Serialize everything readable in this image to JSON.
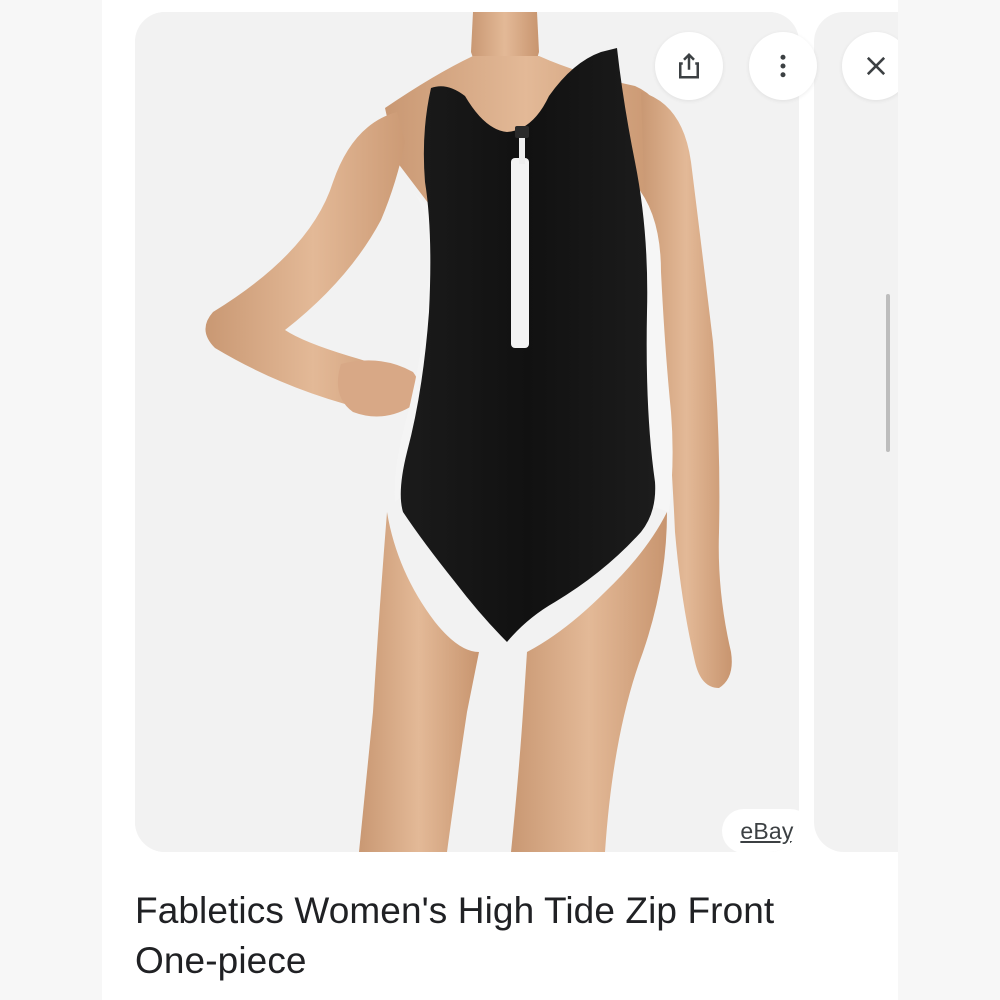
{
  "product": {
    "title": "Fabletics Women's High Tide Zip Front One-piece",
    "source": "eBay",
    "image_alt": "Black one-piece swimsuit with white side panels and white front zip"
  },
  "actions": {
    "share_icon": "share-icon",
    "more_icon": "more-vert-icon",
    "close_icon": "close-icon"
  },
  "colors": {
    "swimsuit_black": "#141414",
    "panel_white": "#f4f4f4",
    "skin": "#dcb08f",
    "title_text": "#202124"
  }
}
